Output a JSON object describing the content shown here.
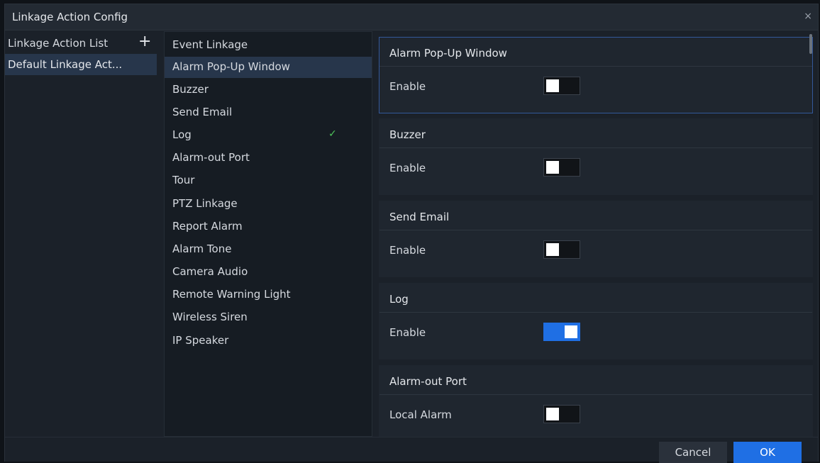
{
  "window": {
    "title": "Linkage Action Config",
    "close_glyph": "×"
  },
  "action_list": {
    "header": "Linkage Action List",
    "add_glyph": "+",
    "items": [
      {
        "label": "Default Linkage Act..."
      }
    ]
  },
  "event_linkage": {
    "header": "Event Linkage",
    "items": [
      {
        "label": "Alarm Pop-Up Window",
        "selected": true
      },
      {
        "label": "Buzzer"
      },
      {
        "label": "Send Email"
      },
      {
        "label": "Log",
        "checked": true
      },
      {
        "label": "Alarm-out Port"
      },
      {
        "label": "Tour"
      },
      {
        "label": "PTZ Linkage"
      },
      {
        "label": "Report Alarm"
      },
      {
        "label": "Alarm Tone"
      },
      {
        "label": "Camera Audio"
      },
      {
        "label": "Remote Warning Light"
      },
      {
        "label": "Wireless Siren"
      },
      {
        "label": "IP Speaker"
      }
    ],
    "check_glyph": "✓"
  },
  "settings": {
    "cards": [
      {
        "title": "Alarm Pop-Up Window",
        "field": "Enable",
        "enabled": false
      },
      {
        "title": "Buzzer",
        "field": "Enable",
        "enabled": false
      },
      {
        "title": "Send Email",
        "field": "Enable",
        "enabled": false
      },
      {
        "title": "Log",
        "field": "Enable",
        "enabled": true
      },
      {
        "title": "Alarm-out Port",
        "field": "Local Alarm",
        "enabled": false
      }
    ]
  },
  "footer": {
    "cancel_label": "Cancel",
    "ok_label": "OK"
  },
  "colors": {
    "accent": "#1f6fe4",
    "selected_row": "#27364b",
    "check": "#4ec25a"
  }
}
